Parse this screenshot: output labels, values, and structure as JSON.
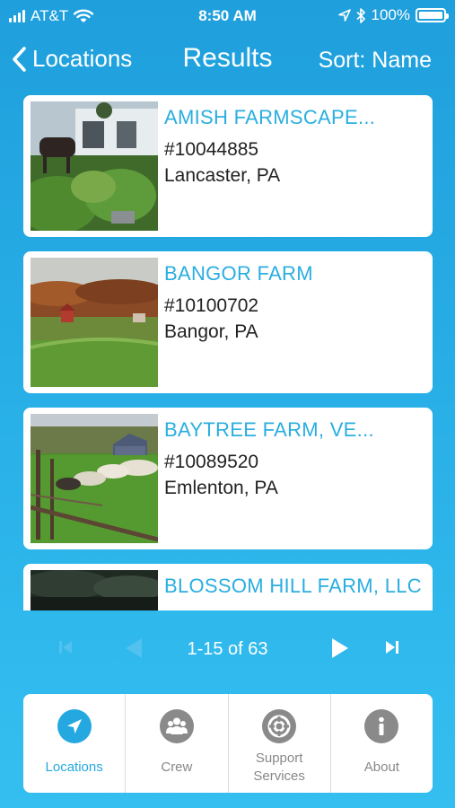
{
  "status_bar": {
    "carrier": "AT&T",
    "time": "8:50 AM",
    "battery": "100%"
  },
  "nav": {
    "back_label": "Locations",
    "title": "Results",
    "sort_label": "Sort: Name"
  },
  "results": [
    {
      "name": "AMISH FARMSCAPE...",
      "number": "#10044885",
      "city": "Lancaster, PA"
    },
    {
      "name": "BANGOR FARM",
      "number": "#10100702",
      "city": "Bangor, PA"
    },
    {
      "name": "BAYTREE FARM, VE...",
      "number": "#10089520",
      "city": "Emlenton, PA"
    },
    {
      "name": "BLOSSOM HILL FARM, LLC"
    }
  ],
  "pager": {
    "range_text": "1-15 of 63"
  },
  "tabs": [
    {
      "label": "Locations",
      "icon": "location-arrow-icon",
      "active": true
    },
    {
      "label": "Crew",
      "icon": "people-icon"
    },
    {
      "label_line1": "Support",
      "label_line2": "Services",
      "icon": "lifebuoy-icon"
    },
    {
      "label": "About",
      "icon": "info-icon"
    }
  ],
  "colors": {
    "accent": "#2aaee0",
    "background": "#29b1e8",
    "inactive": "#8a8a8a"
  }
}
